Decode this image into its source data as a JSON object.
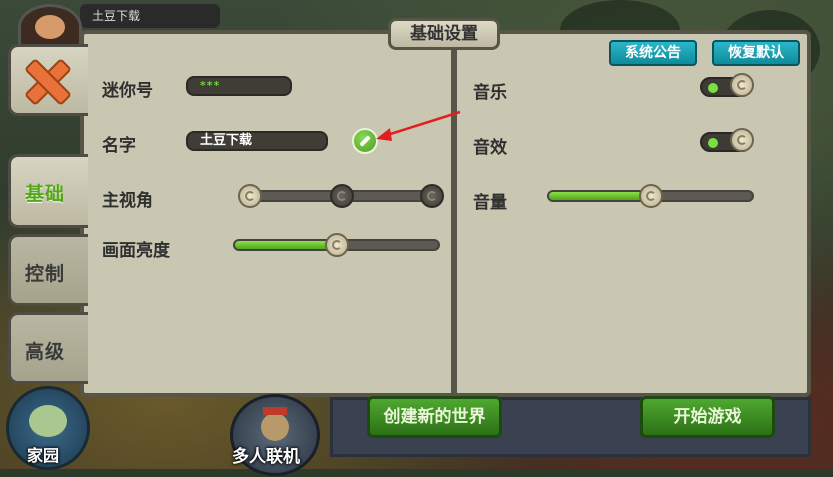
{
  "player": {
    "name": "土豆下载"
  },
  "tabs": {
    "basic": "基础",
    "control": "控制",
    "advanced": "高级"
  },
  "panel": {
    "title": "基础设置",
    "announce_btn": "系统公告",
    "restore_btn": "恢复默认"
  },
  "left": {
    "mini_id": {
      "label": "迷你号",
      "value": "***"
    },
    "name": {
      "label": "名字",
      "value": "土豆下载"
    },
    "view": {
      "label": "主视角",
      "selected_index": 0,
      "positions": 3
    },
    "brightness": {
      "label": "画面亮度",
      "value": 0.5
    }
  },
  "right": {
    "music": {
      "label": "音乐",
      "on": true
    },
    "sfx": {
      "label": "音效",
      "on": true
    },
    "volume": {
      "label": "音量",
      "value": 0.5
    }
  },
  "bottom": {
    "home": "家园",
    "multiplayer": "多人联机",
    "create_world": "创建新的世界",
    "start_game": "开始游戏"
  },
  "colors": {
    "accent_green": "#54a818",
    "button_teal": "#0e8b9b",
    "annotation_red": "#e02020"
  },
  "icons": [
    "close-icon",
    "edit-pencil-icon",
    "home-icon",
    "multiplayer-icon",
    "annotation-arrow"
  ]
}
